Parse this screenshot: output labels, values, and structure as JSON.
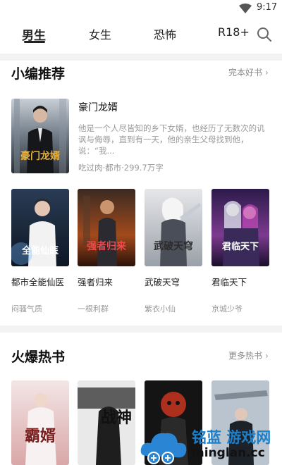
{
  "status_bar": {
    "time": "9:17",
    "wifi_icon": "wifi-icon"
  },
  "tabs": [
    {
      "label": "男生",
      "active": true
    },
    {
      "label": "女生",
      "active": false
    },
    {
      "label": "恐怖",
      "active": false
    },
    {
      "label": "R18+",
      "active": false
    }
  ],
  "search_icon": "search-icon",
  "section1": {
    "title": "小编推荐",
    "link": "完本好书",
    "featured": {
      "title": "豪门龙婿",
      "description": "他是一个人尽皆知的乡下女婿，也经历了无数次的讥讽与侮辱，直到有一天，他的亲生父母找到他，说：“我...",
      "meta": "吃过肉·都市·299.7万字",
      "cover_text": "豪门龙婿"
    },
    "books": [
      {
        "title": "都市全能仙医",
        "author": "闷骚气质",
        "cover_text": "全能仙医"
      },
      {
        "title": "强者归来",
        "author": "一根利群",
        "cover_text": "强者归来"
      },
      {
        "title": "武破天穹",
        "author": "紫衣小仙",
        "cover_text": "武破天穹"
      },
      {
        "title": "君临天下",
        "author": "京城少爷",
        "cover_text": "君临天下"
      }
    ]
  },
  "section2": {
    "title": "火爆热书",
    "link": "更多热书",
    "books": [
      {
        "cover_text": "霸婿"
      },
      {
        "cover_text": "战神"
      },
      {
        "cover_text": ""
      },
      {
        "cover_text": ""
      }
    ]
  },
  "watermark": {
    "cn": "铭蓝 游戏网",
    "en": "minglan.cc"
  },
  "colors": {
    "accent": "#1e7fc9",
    "text": "#222222",
    "muted": "#999999"
  }
}
